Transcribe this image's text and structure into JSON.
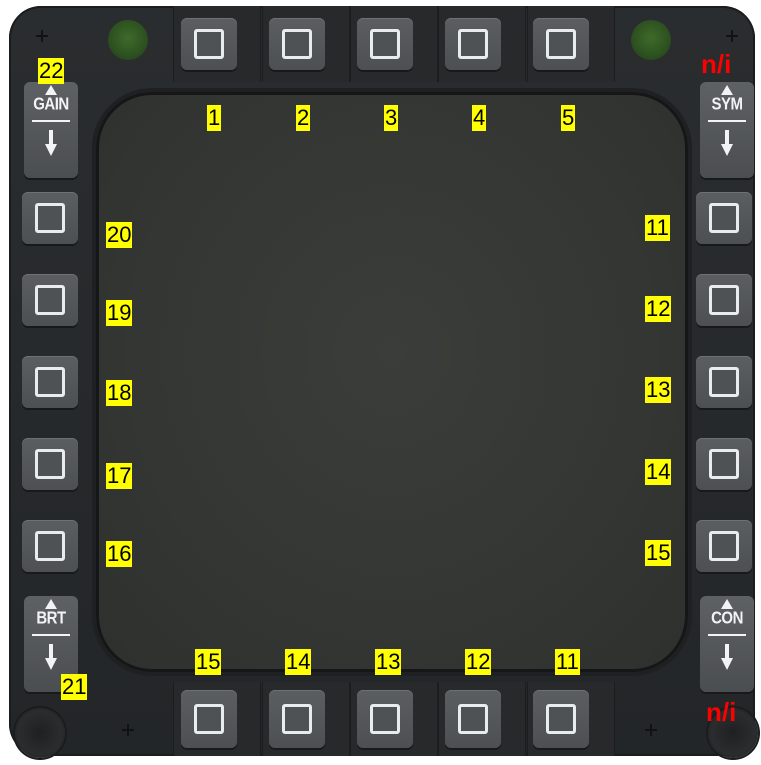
{
  "top_buttons": [
    "1",
    "2",
    "3",
    "4",
    "5"
  ],
  "right_buttons": [
    "11",
    "12",
    "13",
    "14",
    "15"
  ],
  "left_buttons": [
    "20",
    "19",
    "18",
    "17",
    "16"
  ],
  "bottom_buttons": [
    "15",
    "14",
    "13",
    "12",
    "11"
  ],
  "rockers": {
    "gain": {
      "label": "GAIN",
      "number": "22"
    },
    "sym": {
      "label": "SYM",
      "note": "n/i"
    },
    "brt": {
      "label": "BRT",
      "number": "21"
    },
    "con": {
      "label": "CON",
      "note": "n/i"
    }
  },
  "colors": {
    "tag_background": "#ffff00",
    "note_text": "#ff0000",
    "led": "#2d5120",
    "bezel": "#2a2d2f"
  }
}
